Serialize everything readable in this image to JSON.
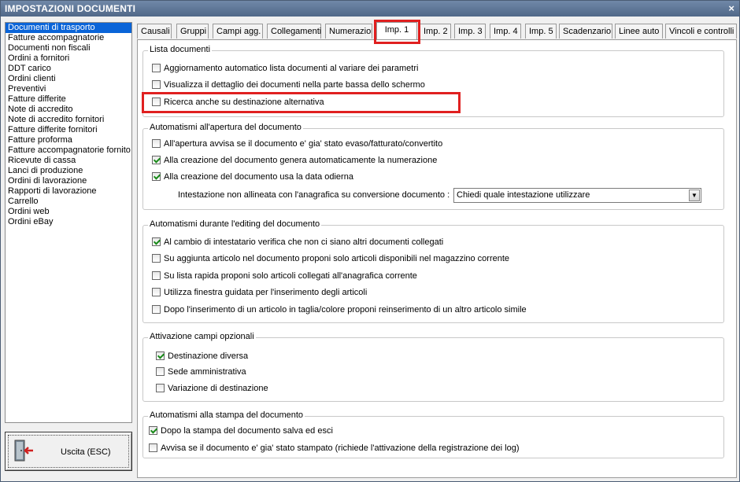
{
  "window": {
    "title": "IMPOSTAZIONI DOCUMENTI",
    "close_glyph": "×"
  },
  "sidebar": {
    "items": [
      "Documenti di trasporto",
      "Fatture accompagnatorie",
      "Documenti non fiscali",
      "Ordini a fornitori",
      "DDT carico",
      "Ordini clienti",
      "Preventivi",
      "Fatture differite",
      "Note di accredito",
      "Note di accredito fornitori",
      "Fatture differite fornitori",
      "Fatture proforma",
      "Fatture accompagnatorie fornito",
      "Ricevute di cassa",
      "Lanci di produzione",
      "Ordini di lavorazione",
      "Rapporti di lavorazione",
      "Carrello",
      "Ordini web",
      "Ordini eBay"
    ],
    "selected_index": 0
  },
  "exit_button": {
    "label": "Uscita (ESC)",
    "icon": "exit-door-icon"
  },
  "tabs": {
    "items": [
      "Causali",
      "Gruppi",
      "Campi agg.",
      "Collegamenti",
      "Numerazione",
      "Imp. 1",
      "Imp. 2",
      "Imp. 3",
      "Imp. 4",
      "Imp. 5",
      "Scadenzario",
      "Linee auto",
      "Vincoli e controlli"
    ],
    "active_index": 5
  },
  "groups": {
    "lista": {
      "title": "Lista documenti",
      "options": [
        {
          "label": "Aggiornamento automatico lista documenti al variare dei parametri",
          "checked": false
        },
        {
          "label": "Visualizza il dettaglio dei documenti nella parte bassa dello schermo",
          "checked": false
        },
        {
          "label": "Ricerca anche su destinazione alternativa",
          "checked": false
        }
      ]
    },
    "apertura": {
      "title": "Automatismi all'apertura del documento",
      "options": [
        {
          "label": "All'apertura avvisa se il documento e' gia' stato evaso/fatturato/convertito",
          "checked": false
        },
        {
          "label": "Alla creazione del documento genera automaticamente la numerazione",
          "checked": true
        },
        {
          "label": "Alla creazione del documento usa la data odierna",
          "checked": true
        }
      ],
      "intestazione_label": "Intestazione non allineata con l'anagrafica su conversione documento :",
      "intestazione_value": "Chiedi quale intestazione utilizzare"
    },
    "editing": {
      "title": "Automatismi durante l'editing del documento",
      "options": [
        {
          "label": "Al cambio di intestatario verifica che non ci siano altri documenti collegati",
          "checked": true
        },
        {
          "label": "Su aggiunta articolo nel documento proponi solo articoli disponibili nel magazzino corrente",
          "checked": false
        },
        {
          "label": "Su lista rapida proponi solo articoli collegati all'anagrafica corrente",
          "checked": false
        },
        {
          "label": "Utilizza finestra guidata per l'inserimento degli articoli",
          "checked": false
        },
        {
          "label": "Dopo l'inserimento di un articolo in taglia/colore proponi reinserimento di un altro articolo simile",
          "checked": false
        }
      ]
    },
    "campi": {
      "title": "Attivazione campi opzionali",
      "options": [
        {
          "label": "Destinazione diversa",
          "checked": true
        },
        {
          "label": "Sede amministrativa",
          "checked": false
        },
        {
          "label": "Variazione di destinazione",
          "checked": false
        }
      ]
    },
    "stampa": {
      "title": "Automatismi alla stampa del documento",
      "options": [
        {
          "label": "Dopo la stampa del documento salva ed esci",
          "checked": true
        },
        {
          "label": "Avvisa se il documento e' gia' stato stampato (richiede l'attivazione della registrazione dei log)",
          "checked": false
        }
      ]
    }
  }
}
